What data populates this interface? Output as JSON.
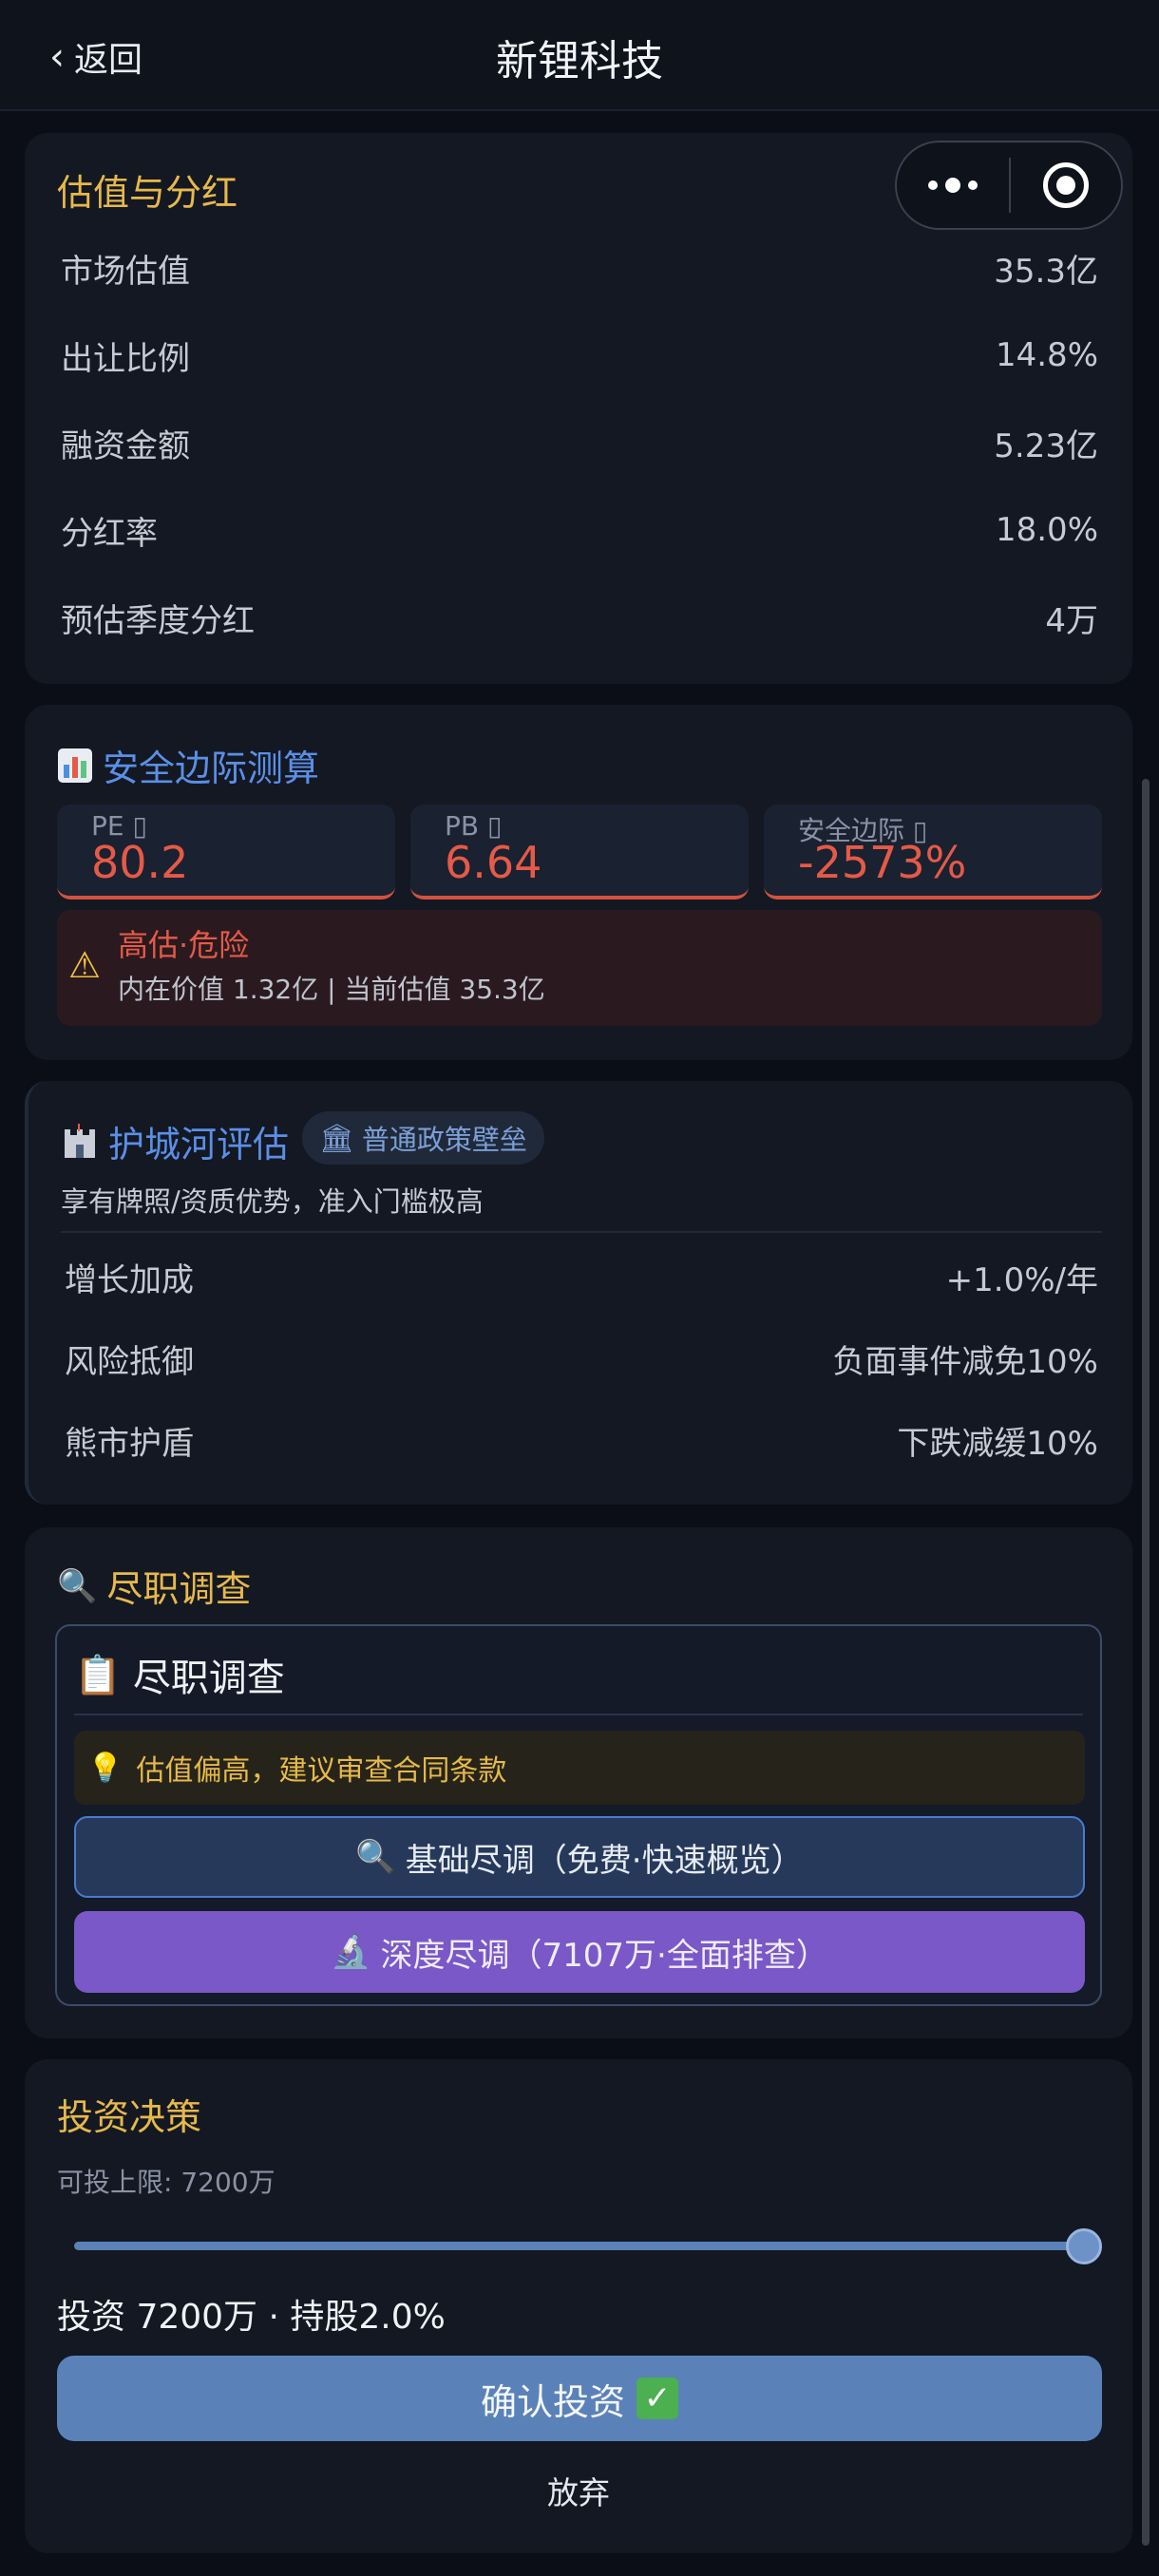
{
  "header": {
    "back_label": "返回",
    "title": "新锂科技"
  },
  "valuation": {
    "title": "估值与分红",
    "rows": [
      {
        "label": "市场估值",
        "value": "35.3亿"
      },
      {
        "label": "出让比例",
        "value": "14.8%"
      },
      {
        "label": "融资金额",
        "value": "5.23亿"
      },
      {
        "label": "分红率",
        "value": "18.0%"
      },
      {
        "label": "预估季度分红",
        "value": "4万"
      }
    ]
  },
  "safety": {
    "icon": "bar-chart-icon",
    "title": "安全边际测算",
    "metrics": [
      {
        "label": "PE",
        "value": "80.2"
      },
      {
        "label": "PB",
        "value": "6.64"
      },
      {
        "label": "安全边际",
        "value": "-2573%"
      }
    ],
    "warning": {
      "title": "高估·危险",
      "detail": "内在价值 1.32亿 | 当前估值 35.3亿"
    }
  },
  "moat": {
    "icon": "castle-icon",
    "title": "护城河评估",
    "tag": "普通政策壁垒",
    "description": "享有牌照/资质优势，准入门槛极高",
    "rows": [
      {
        "label": "增长加成",
        "value": "+1.0%/年"
      },
      {
        "label": "风险抵御",
        "value": "负面事件减免10%"
      },
      {
        "label": "熊市护盾",
        "value": "下跌减缓10%"
      }
    ]
  },
  "due_diligence": {
    "title": "尽职调查",
    "box_title": "尽职调查",
    "tip": "估值偏高，建议审查合同条款",
    "basic_button": "基础尽调（免费·快速概览）",
    "deep_button": "深度尽调（7107万·全面排查）"
  },
  "invest": {
    "title": "投资决策",
    "limit": "可投上限: 7200万",
    "slider_fraction": 1.0,
    "summary": "投资 7200万 · 持股2.0%",
    "confirm_button": "确认投资",
    "abandon_button": "放弃"
  }
}
